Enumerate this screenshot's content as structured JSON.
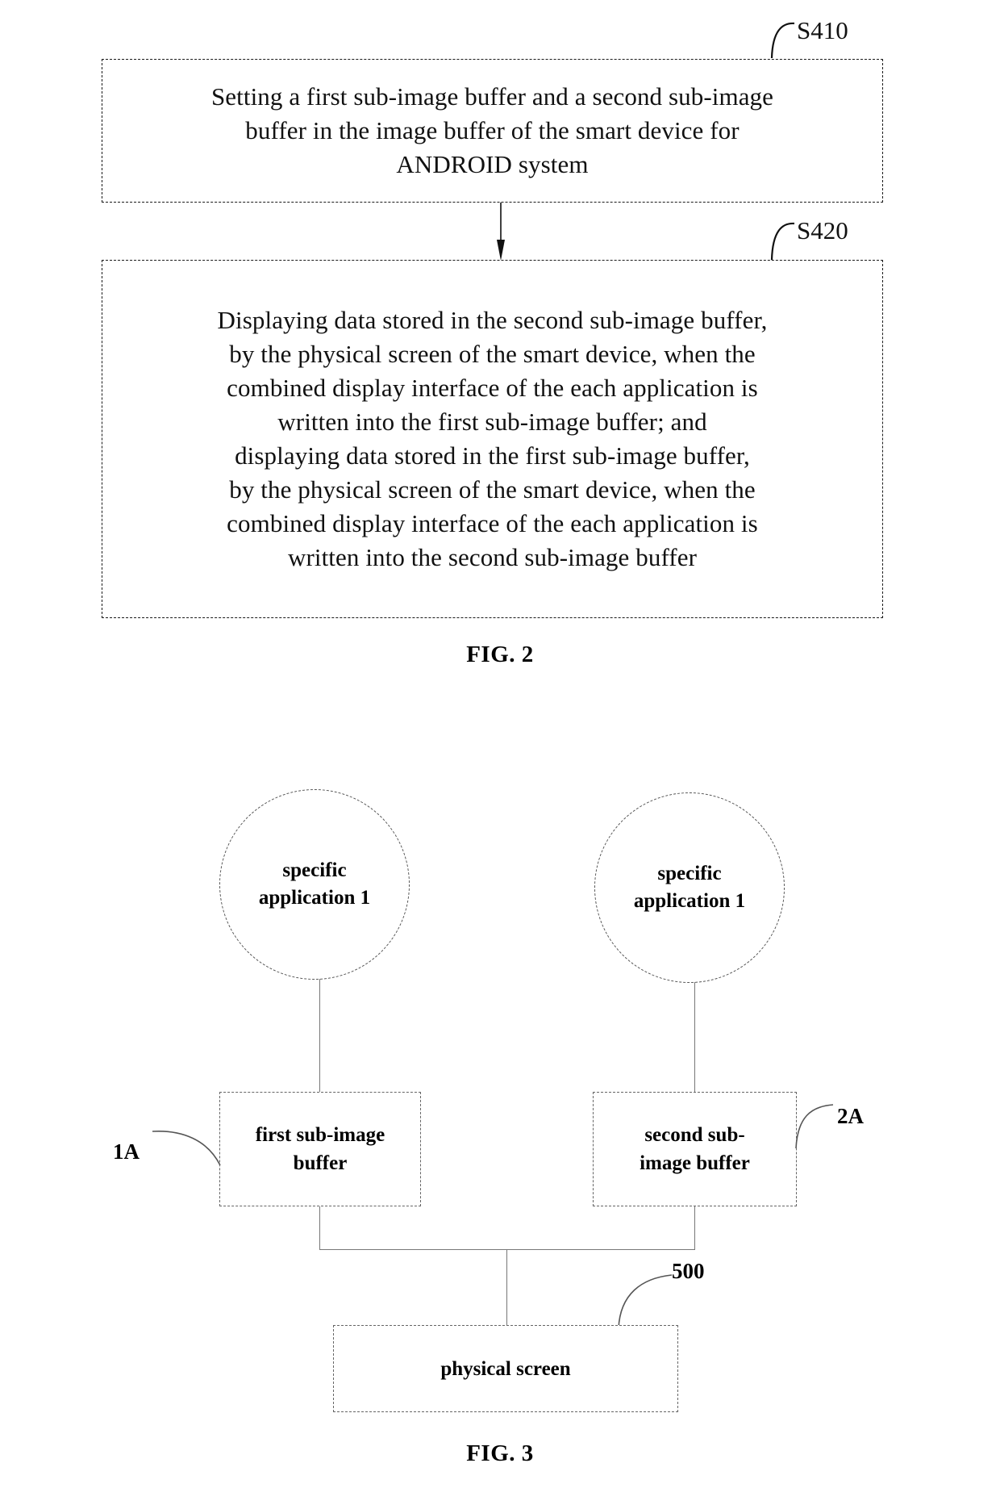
{
  "figures": [
    {
      "id": "fig2",
      "caption": "FIG. 2",
      "type": "flowchart",
      "steps": [
        {
          "ref": "S410",
          "text": "Setting a first sub-image buffer and a second sub-image buffer in the image buffer of the smart device for ANDROID system"
        },
        {
          "ref": "S420",
          "text": "Displaying data stored in the second sub-image buffer, by the physical screen of the smart device, when the combined display interface of the each application is written into the first sub-image buffer; and displaying data stored in the first sub-image buffer, by the physical screen of the smart device, when the combined display interface of the each application is written into the second sub-image buffer"
        }
      ]
    },
    {
      "id": "fig3",
      "caption": "FIG. 3",
      "type": "block-diagram",
      "nodes": {
        "app_left": {
          "label": "specific application 1"
        },
        "app_right": {
          "label": "specific application 1"
        },
        "first_buffer": {
          "label": "first sub-image buffer",
          "ref": "1A"
        },
        "second_buffer": {
          "label": "second sub-image buffer",
          "ref": "2A"
        },
        "physical_screen": {
          "label": "physical screen",
          "ref": "500"
        }
      }
    }
  ],
  "fig2": {
    "s410": {
      "ref": "S410",
      "line1": "Setting a first sub-image buffer and a second sub-image",
      "line2": "buffer in the image buffer of the smart device for",
      "line3": "ANDROID system"
    },
    "s420": {
      "ref": "S420",
      "line1": "Displaying data stored in the second sub-image buffer,",
      "line2": "by the physical screen of the smart device, when the",
      "line3": "combined display interface of the each application is",
      "line4": "written into the first sub-image buffer; and",
      "line5": "displaying data stored in the first sub-image buffer,",
      "line6": "by the physical screen of the smart device, when the",
      "line7": "combined display interface of the each application is",
      "line8": "written into the second sub-image buffer"
    },
    "caption": "FIG. 2"
  },
  "fig3": {
    "app_left": {
      "line1": "specific",
      "line2": "application 1"
    },
    "app_right": {
      "line1": "specific",
      "line2": "application 1"
    },
    "first_buffer": {
      "line1": "first sub-image",
      "line2": "buffer",
      "ref": "1A"
    },
    "second_buffer": {
      "line1": "second sub-",
      "line2": "image buffer",
      "ref": "2A"
    },
    "physical_screen": {
      "label": "physical screen",
      "ref": "500"
    },
    "caption": "FIG. 3"
  },
  "colors": {
    "ink": "#111111",
    "line": "#777777",
    "background": "#ffffff"
  }
}
